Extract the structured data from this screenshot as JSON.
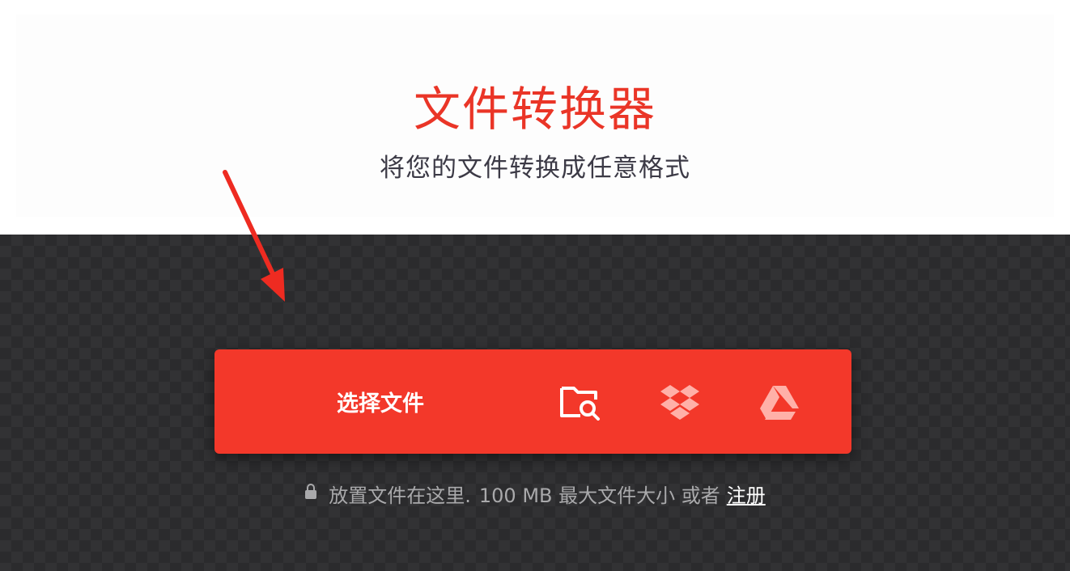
{
  "hero": {
    "title": "文件转换器",
    "subtitle": "将您的文件转换成任意格式"
  },
  "upload": {
    "choose_label": "选择文件",
    "sources": [
      {
        "icon": "folder-search-icon"
      },
      {
        "icon": "dropbox-icon"
      },
      {
        "icon": "google-drive-icon"
      }
    ]
  },
  "hint": {
    "drop_text": "放置文件在这里.",
    "size_text": "100 MB 最大文件大小 或者",
    "signup_label": "注册"
  },
  "colors": {
    "accent": "#f3382a",
    "title": "#ea3527",
    "dark_bg": "#2b2b2d"
  }
}
